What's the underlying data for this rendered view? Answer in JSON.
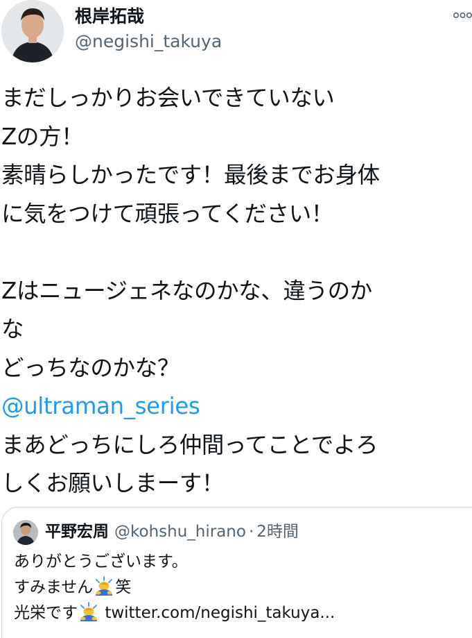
{
  "tweet": {
    "author": {
      "display_name": "根岸拓哉",
      "handle": "@negishi_takuya",
      "avatar_icon": "profile-photo-icon"
    },
    "more_icon": "more-options-icon",
    "lines": [
      "まだしっかりお会いできていない",
      "Zの方！",
      "素晴らしかったです！最後までお身体",
      "に気をつけて頑張ってください！",
      "",
      "Zはニュージェネなのかな、違うのか",
      "な",
      "どっちなのかな？"
    ],
    "mention": "@ultraman_series",
    "lines_after": [
      "まあどっちにしろ仲間ってことでよろ",
      "しくお願いしまーす！"
    ],
    "link_color": "#1d9bf0"
  },
  "quote": {
    "display_name": "平野宏周",
    "handle": "@kohshu_hirano",
    "separator": "·",
    "time": "2時間",
    "line1": "ありがとうございます。",
    "line2_text": "すみません",
    "line2_suffix": "笑",
    "line3_text": "光栄です",
    "line3_link": "twitter.com/negishi_takuya...",
    "emoji_icon": "person-bowing-emoji-icon"
  }
}
